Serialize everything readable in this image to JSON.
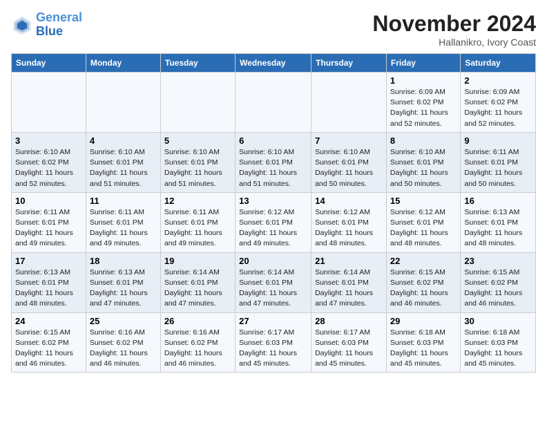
{
  "header": {
    "logo_line1": "General",
    "logo_line2": "Blue",
    "month": "November 2024",
    "location": "Hallanikro, Ivory Coast"
  },
  "weekdays": [
    "Sunday",
    "Monday",
    "Tuesday",
    "Wednesday",
    "Thursday",
    "Friday",
    "Saturday"
  ],
  "weeks": [
    [
      {
        "day": "",
        "info": ""
      },
      {
        "day": "",
        "info": ""
      },
      {
        "day": "",
        "info": ""
      },
      {
        "day": "",
        "info": ""
      },
      {
        "day": "",
        "info": ""
      },
      {
        "day": "1",
        "info": "Sunrise: 6:09 AM\nSunset: 6:02 PM\nDaylight: 11 hours\nand 52 minutes."
      },
      {
        "day": "2",
        "info": "Sunrise: 6:09 AM\nSunset: 6:02 PM\nDaylight: 11 hours\nand 52 minutes."
      }
    ],
    [
      {
        "day": "3",
        "info": "Sunrise: 6:10 AM\nSunset: 6:02 PM\nDaylight: 11 hours\nand 52 minutes."
      },
      {
        "day": "4",
        "info": "Sunrise: 6:10 AM\nSunset: 6:01 PM\nDaylight: 11 hours\nand 51 minutes."
      },
      {
        "day": "5",
        "info": "Sunrise: 6:10 AM\nSunset: 6:01 PM\nDaylight: 11 hours\nand 51 minutes."
      },
      {
        "day": "6",
        "info": "Sunrise: 6:10 AM\nSunset: 6:01 PM\nDaylight: 11 hours\nand 51 minutes."
      },
      {
        "day": "7",
        "info": "Sunrise: 6:10 AM\nSunset: 6:01 PM\nDaylight: 11 hours\nand 50 minutes."
      },
      {
        "day": "8",
        "info": "Sunrise: 6:10 AM\nSunset: 6:01 PM\nDaylight: 11 hours\nand 50 minutes."
      },
      {
        "day": "9",
        "info": "Sunrise: 6:11 AM\nSunset: 6:01 PM\nDaylight: 11 hours\nand 50 minutes."
      }
    ],
    [
      {
        "day": "10",
        "info": "Sunrise: 6:11 AM\nSunset: 6:01 PM\nDaylight: 11 hours\nand 49 minutes."
      },
      {
        "day": "11",
        "info": "Sunrise: 6:11 AM\nSunset: 6:01 PM\nDaylight: 11 hours\nand 49 minutes."
      },
      {
        "day": "12",
        "info": "Sunrise: 6:11 AM\nSunset: 6:01 PM\nDaylight: 11 hours\nand 49 minutes."
      },
      {
        "day": "13",
        "info": "Sunrise: 6:12 AM\nSunset: 6:01 PM\nDaylight: 11 hours\nand 49 minutes."
      },
      {
        "day": "14",
        "info": "Sunrise: 6:12 AM\nSunset: 6:01 PM\nDaylight: 11 hours\nand 48 minutes."
      },
      {
        "day": "15",
        "info": "Sunrise: 6:12 AM\nSunset: 6:01 PM\nDaylight: 11 hours\nand 48 minutes."
      },
      {
        "day": "16",
        "info": "Sunrise: 6:13 AM\nSunset: 6:01 PM\nDaylight: 11 hours\nand 48 minutes."
      }
    ],
    [
      {
        "day": "17",
        "info": "Sunrise: 6:13 AM\nSunset: 6:01 PM\nDaylight: 11 hours\nand 48 minutes."
      },
      {
        "day": "18",
        "info": "Sunrise: 6:13 AM\nSunset: 6:01 PM\nDaylight: 11 hours\nand 47 minutes."
      },
      {
        "day": "19",
        "info": "Sunrise: 6:14 AM\nSunset: 6:01 PM\nDaylight: 11 hours\nand 47 minutes."
      },
      {
        "day": "20",
        "info": "Sunrise: 6:14 AM\nSunset: 6:01 PM\nDaylight: 11 hours\nand 47 minutes."
      },
      {
        "day": "21",
        "info": "Sunrise: 6:14 AM\nSunset: 6:01 PM\nDaylight: 11 hours\nand 47 minutes."
      },
      {
        "day": "22",
        "info": "Sunrise: 6:15 AM\nSunset: 6:02 PM\nDaylight: 11 hours\nand 46 minutes."
      },
      {
        "day": "23",
        "info": "Sunrise: 6:15 AM\nSunset: 6:02 PM\nDaylight: 11 hours\nand 46 minutes."
      }
    ],
    [
      {
        "day": "24",
        "info": "Sunrise: 6:15 AM\nSunset: 6:02 PM\nDaylight: 11 hours\nand 46 minutes."
      },
      {
        "day": "25",
        "info": "Sunrise: 6:16 AM\nSunset: 6:02 PM\nDaylight: 11 hours\nand 46 minutes."
      },
      {
        "day": "26",
        "info": "Sunrise: 6:16 AM\nSunset: 6:02 PM\nDaylight: 11 hours\nand 46 minutes."
      },
      {
        "day": "27",
        "info": "Sunrise: 6:17 AM\nSunset: 6:03 PM\nDaylight: 11 hours\nand 45 minutes."
      },
      {
        "day": "28",
        "info": "Sunrise: 6:17 AM\nSunset: 6:03 PM\nDaylight: 11 hours\nand 45 minutes."
      },
      {
        "day": "29",
        "info": "Sunrise: 6:18 AM\nSunset: 6:03 PM\nDaylight: 11 hours\nand 45 minutes."
      },
      {
        "day": "30",
        "info": "Sunrise: 6:18 AM\nSunset: 6:03 PM\nDaylight: 11 hours\nand 45 minutes."
      }
    ]
  ]
}
